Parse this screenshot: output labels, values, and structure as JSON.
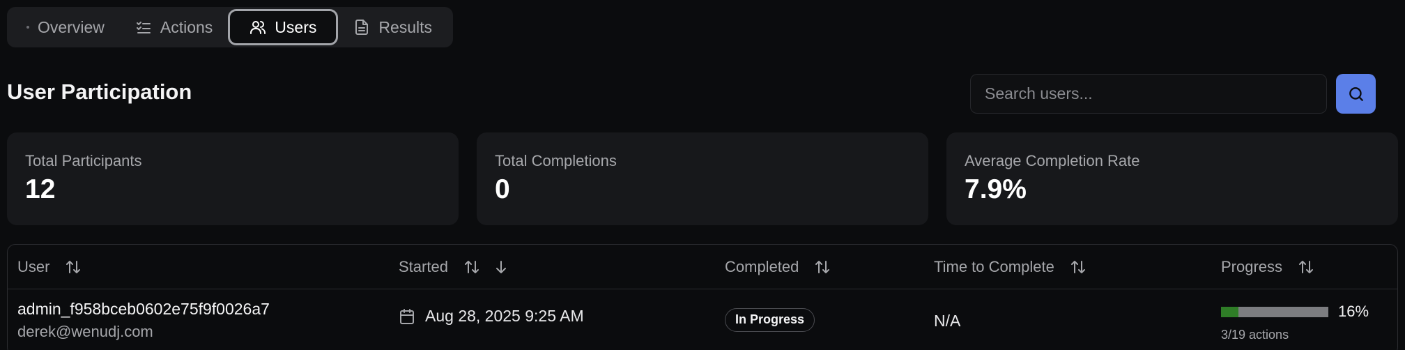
{
  "tabs": [
    {
      "label": "Overview",
      "icon": "dot-icon"
    },
    {
      "label": "Actions",
      "icon": "list-check-icon"
    },
    {
      "label": "Users",
      "icon": "users-icon",
      "active": true
    },
    {
      "label": "Results",
      "icon": "document-icon"
    }
  ],
  "page": {
    "title": "User Participation"
  },
  "search": {
    "placeholder": "Search users...",
    "value": "",
    "button_icon": "search-icon"
  },
  "stats": [
    {
      "label": "Total Participants",
      "value": "12"
    },
    {
      "label": "Total Completions",
      "value": "0"
    },
    {
      "label": "Average Completion Rate",
      "value": "7.9%"
    }
  ],
  "table": {
    "columns": [
      "User",
      "Started",
      "Completed",
      "Time to Complete",
      "Progress"
    ],
    "sort_active_column": "Started",
    "sort_direction": "descending",
    "rows": [
      {
        "user": "admin_f958bceb0602e75f9f0026a7",
        "email": "derek@wenudj.com",
        "started": "Aug 28, 2025 9:25 AM",
        "completed": "In Progress",
        "time_to_complete": "N/A",
        "progress_pct": "16%",
        "progress_value": 0.16,
        "progress_detail": "3/19 actions"
      }
    ]
  },
  "colors": {
    "background": "#0b0c0e",
    "accent": "#5b7fe8",
    "progress_fill": "#2f7d27",
    "progress_track": "#7c7d80"
  }
}
